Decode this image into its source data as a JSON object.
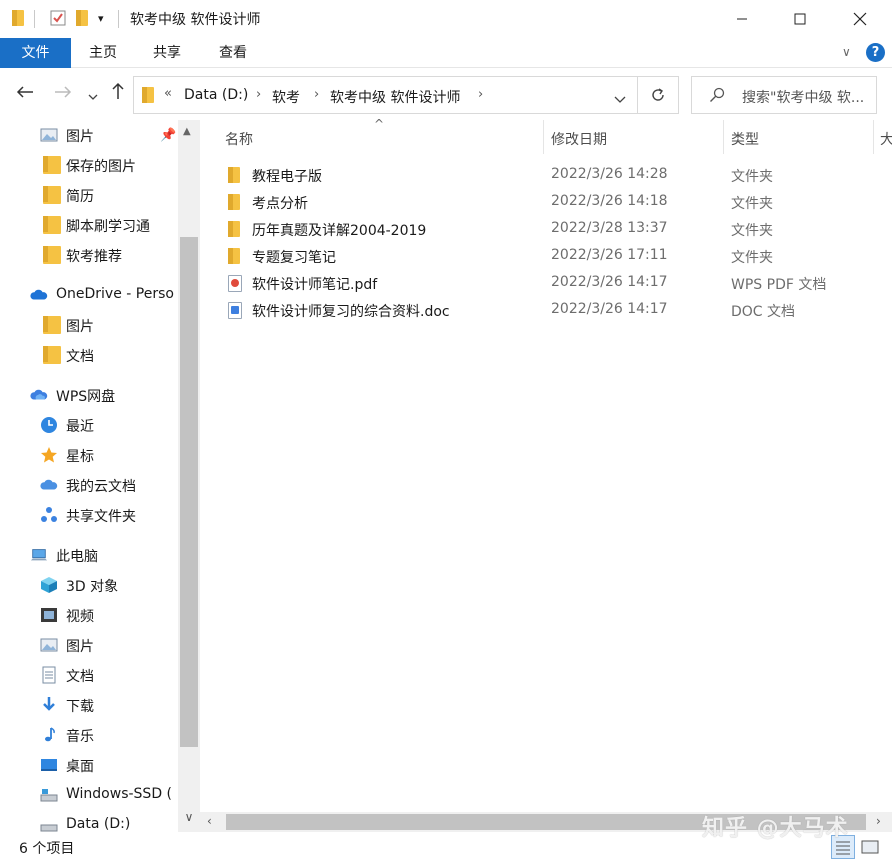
{
  "window": {
    "title": "软考中级 软件设计师",
    "minimize_icon": "minimize-icon",
    "maximize_icon": "maximize-icon",
    "close_icon": "close-icon"
  },
  "ribbon": {
    "tabs": [
      {
        "label": "文件",
        "active": true
      },
      {
        "label": "主页",
        "active": false
      },
      {
        "label": "共享",
        "active": false
      },
      {
        "label": "查看",
        "active": false
      }
    ],
    "accent": "#1a6fc6"
  },
  "address": {
    "overflow": "«",
    "crumbs": [
      "Data (D:)",
      "软考",
      "软考中级 软件设计师"
    ]
  },
  "search": {
    "placeholder": "搜索\"软考中级 软..."
  },
  "sidebar": {
    "items": [
      {
        "label": "图片",
        "icon": "pictures-icon",
        "pinned": true
      },
      {
        "label": "保存的图片",
        "icon": "folder-icon"
      },
      {
        "label": "简历",
        "icon": "folder-icon"
      },
      {
        "label": "脚本刷学习通",
        "icon": "folder-icon"
      },
      {
        "label": "软考推荐",
        "icon": "folder-icon"
      },
      {
        "label": "OneDrive - Perso",
        "icon": "onedrive-icon"
      },
      {
        "label": "图片",
        "icon": "folder-icon"
      },
      {
        "label": "文档",
        "icon": "folder-icon"
      },
      {
        "label": "WPS网盘",
        "icon": "wps-cloud-icon"
      },
      {
        "label": "最近",
        "icon": "clock-icon"
      },
      {
        "label": "星标",
        "icon": "star-icon"
      },
      {
        "label": "我的云文档",
        "icon": "cloud-icon"
      },
      {
        "label": "共享文件夹",
        "icon": "share-icon"
      },
      {
        "label": "此电脑",
        "icon": "computer-icon"
      },
      {
        "label": "3D 对象",
        "icon": "cube-icon"
      },
      {
        "label": "视频",
        "icon": "video-icon"
      },
      {
        "label": "图片",
        "icon": "pictures-icon"
      },
      {
        "label": "文档",
        "icon": "document-icon"
      },
      {
        "label": "下载",
        "icon": "download-icon"
      },
      {
        "label": "音乐",
        "icon": "music-icon"
      },
      {
        "label": "桌面",
        "icon": "desktop-icon"
      },
      {
        "label": "Windows-SSD (",
        "icon": "drive-icon"
      },
      {
        "label": "Data (D:)",
        "icon": "drive-icon"
      }
    ]
  },
  "columns": {
    "name": "名称",
    "date": "修改日期",
    "type": "类型",
    "size": "大"
  },
  "files": [
    {
      "name": "教程电子版",
      "date": "2022/3/26 14:28",
      "type": "文件夹",
      "icon": "folder-icon"
    },
    {
      "name": "考点分析",
      "date": "2022/3/26 14:18",
      "type": "文件夹",
      "icon": "folder-icon"
    },
    {
      "name": "历年真题及详解2004-2019",
      "date": "2022/3/28 13:37",
      "type": "文件夹",
      "icon": "folder-icon"
    },
    {
      "name": "专题复习笔记",
      "date": "2022/3/26 17:11",
      "type": "文件夹",
      "icon": "folder-icon"
    },
    {
      "name": "软件设计师笔记.pdf",
      "date": "2022/3/26 14:17",
      "type": "WPS PDF 文档",
      "icon": "pdf-file-icon"
    },
    {
      "name": "软件设计师复习的综合资料.doc",
      "date": "2022/3/26 14:17",
      "type": "DOC 文档",
      "icon": "doc-file-icon"
    }
  ],
  "status": {
    "count": "6 个项目"
  },
  "watermark": "知乎 @大马术"
}
